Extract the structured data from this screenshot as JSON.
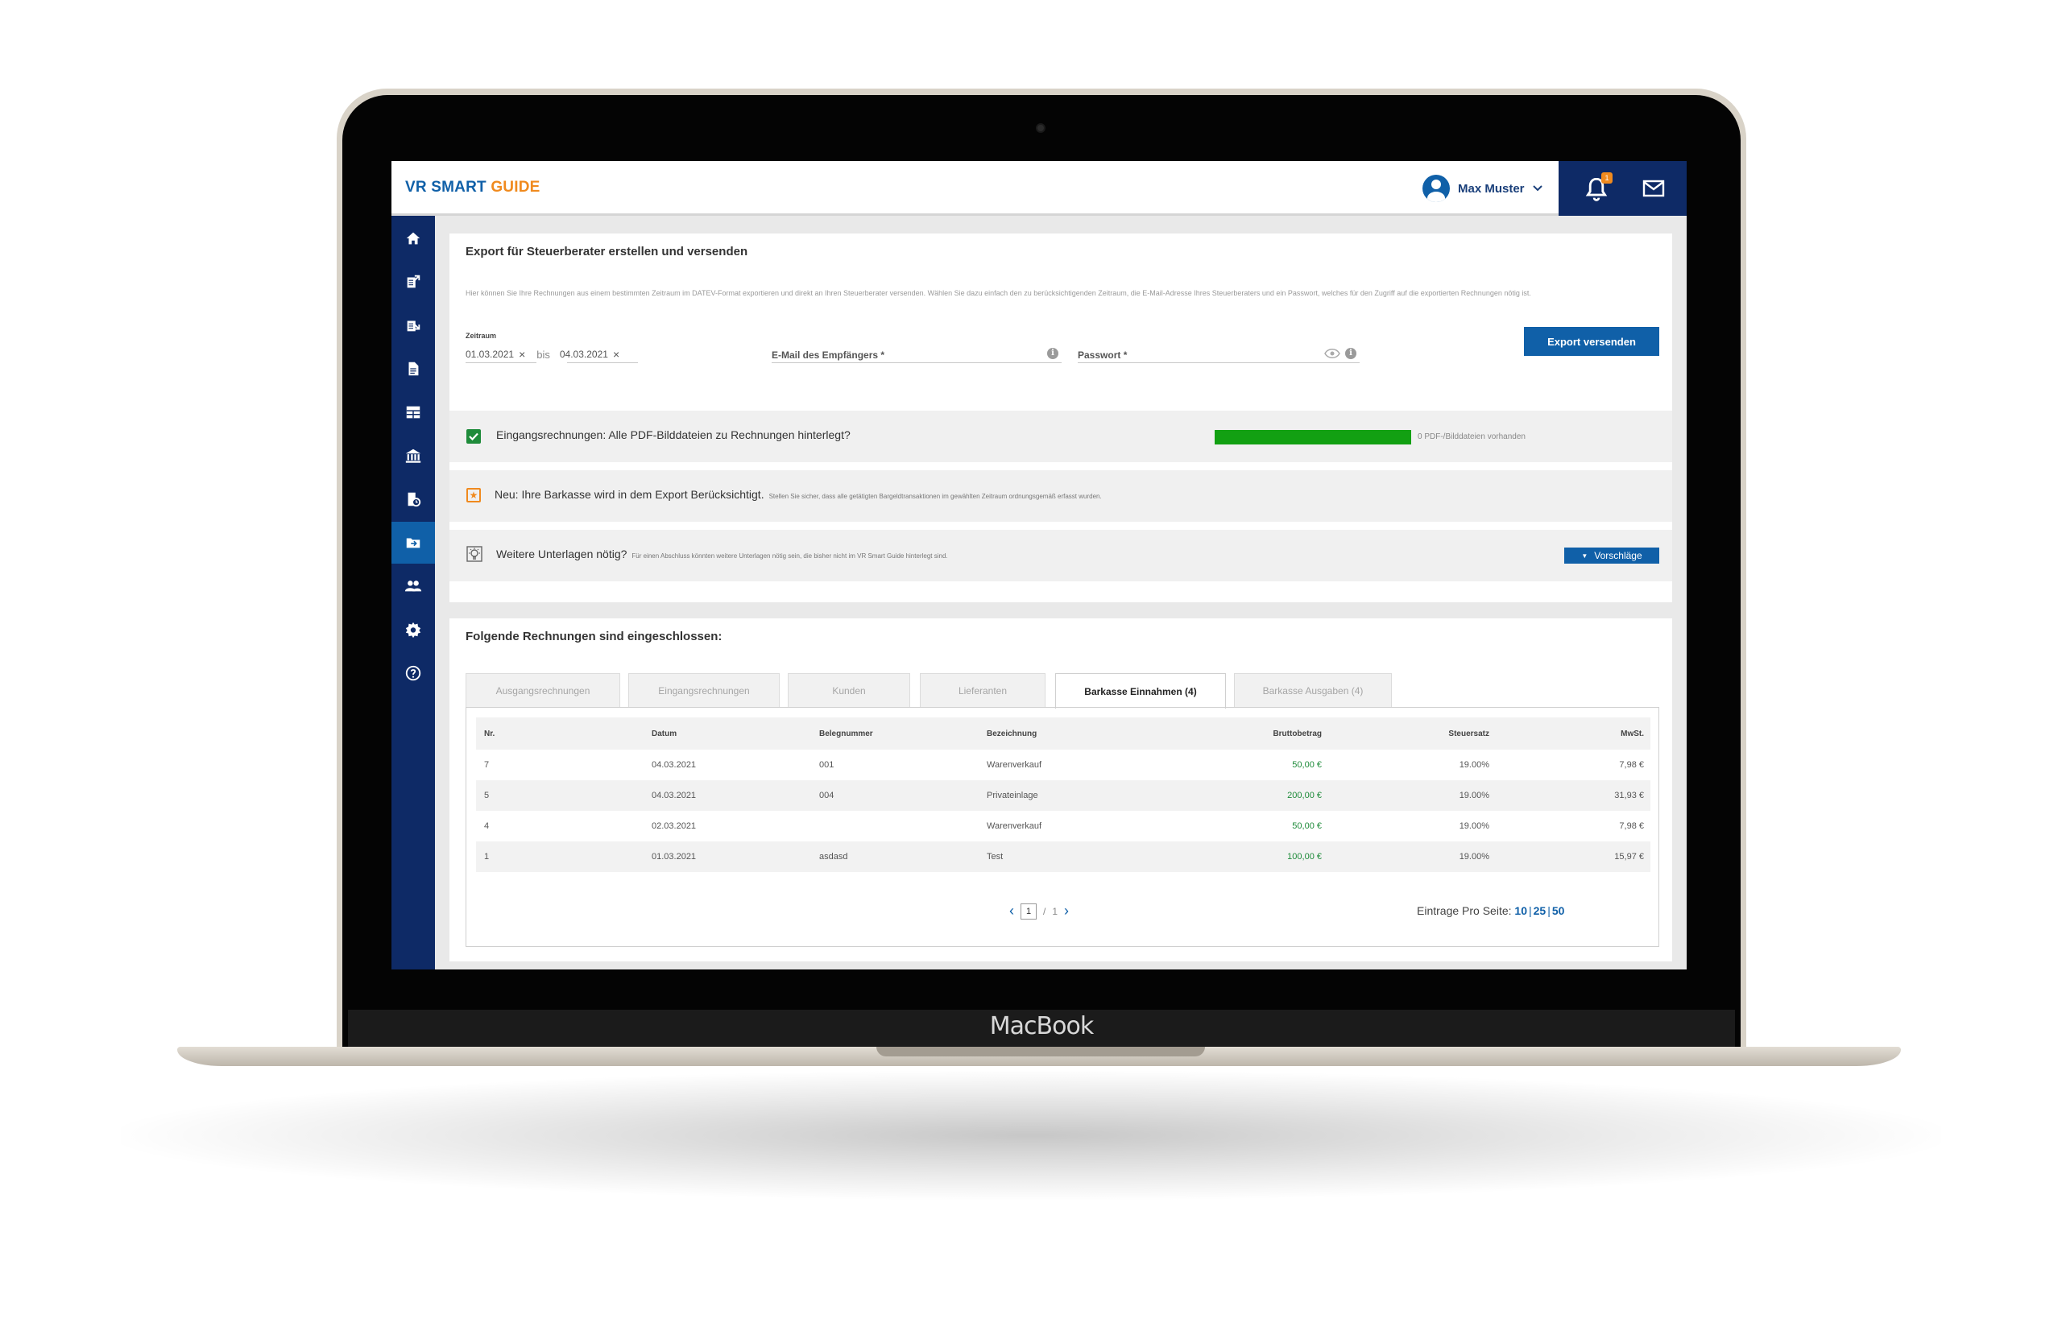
{
  "device": {
    "label": "MacBook"
  },
  "header": {
    "logo_part1": "VR SMART ",
    "logo_part2": "GUIDE",
    "user_name": "Max Muster",
    "notification_count": "1"
  },
  "sidebar": {
    "items": [
      {
        "icon": "home-icon"
      },
      {
        "icon": "outgoing-invoices-icon"
      },
      {
        "icon": "incoming-invoices-icon"
      },
      {
        "icon": "document-icon"
      },
      {
        "icon": "table-icon"
      },
      {
        "icon": "bank-icon"
      },
      {
        "icon": "receipt-clock-icon"
      },
      {
        "icon": "export-folder-icon",
        "active": true
      },
      {
        "icon": "users-icon"
      },
      {
        "icon": "gear-icon"
      },
      {
        "icon": "help-icon"
      }
    ]
  },
  "export_card": {
    "title": "Export für Steuerberater erstellen und versenden",
    "description": "Hier können Sie Ihre Rechnungen aus einem bestimmten Zeitraum im DATEV-Format exportieren und direkt an Ihren Steuerberater versenden. Wählen Sie dazu einfach den zu berücksichtigenden Zeitraum, die E-Mail-Adresse Ihres Steuerberaters und ein Passwort, welches für den Zugriff auf die exportierten Rechnungen nötig ist.",
    "zeitraum_label": "Zeitraum",
    "date_from": "01.03.2021",
    "date_to": "04.03.2021",
    "bis": "bis",
    "clear_symbol": "×",
    "email_label": "E-Mail des Empfängers *",
    "password_label": "Passwort *",
    "export_button": "Export versenden",
    "check_row": {
      "text": "Eingangsrechnungen: Alle PDF-Bilddateien zu Rechnungen hinterlegt?",
      "progress_fraction": 1.0,
      "progress_text": "0 PDF-/Bilddateien vorhanden"
    },
    "cash_row": {
      "text": "Neu: Ihre Barkasse wird in dem Export Berücksichtigt.",
      "note": "Stellen Sie sicher, dass alle getätigten Bargeldtransaktionen im gewählten Zeitraum ordnungsgemäß erfasst wurden."
    },
    "docs_row": {
      "text": "Weitere Unterlagen nötig?",
      "note": "Für einen Abschluss könnten weitere Unterlagen nötig sein, die bisher nicht im VR Smart Guide hinterlegt sind.",
      "button": "Vorschläge"
    }
  },
  "invoices_card": {
    "title": "Folgende Rechnungen sind eingeschlossen:",
    "tabs": [
      {
        "label": "Ausgangsrechnungen"
      },
      {
        "label": "Eingangsrechnungen"
      },
      {
        "label": "Kunden"
      },
      {
        "label": "Lieferanten"
      },
      {
        "label": "Barkasse Einnahmen (4)",
        "active": true
      },
      {
        "label": "Barkasse Ausgaben (4)"
      }
    ],
    "columns": [
      "Nr.",
      "Datum",
      "Belegnummer",
      "Bezeichnung",
      "Bruttobetrag",
      "Steuersatz",
      "MwSt."
    ],
    "rows": [
      [
        "7",
        "04.03.2021",
        "001",
        "Warenverkauf",
        "50,00 €",
        "19.00%",
        "7,98 €"
      ],
      [
        "5",
        "04.03.2021",
        "004",
        "Privateinlage",
        "200,00 €",
        "19.00%",
        "31,93 €"
      ],
      [
        "4",
        "02.03.2021",
        "",
        "Warenverkauf",
        "50,00 €",
        "19.00%",
        "7,98 €"
      ],
      [
        "1",
        "01.03.2021",
        "asdasd",
        "Test",
        "100,00 €",
        "19.00%",
        "15,97 €"
      ]
    ],
    "pagination": {
      "current": "1",
      "sep": "/",
      "total": "1"
    },
    "per_page_label": "Eintrage Pro Seite:",
    "per_page_options": [
      "10",
      "25",
      "50"
    ]
  },
  "colors": {
    "brand_blue": "#1060a8",
    "navy": "#0e2a66",
    "orange": "#f08a1e",
    "green": "#1e8b3a"
  }
}
